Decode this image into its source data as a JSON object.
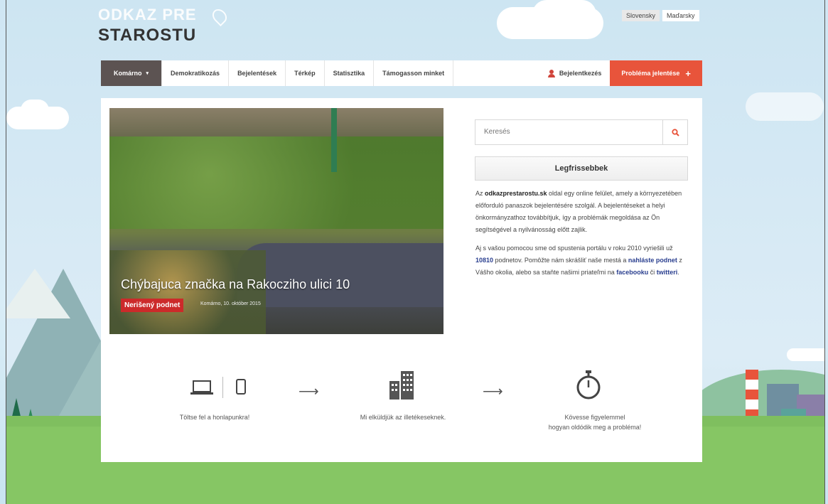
{
  "header": {
    "logo_top": "ODKAZ PRE",
    "logo_bottom": "STAROSTU",
    "languages": [
      "Slovensky",
      "Maďarsky"
    ]
  },
  "nav": {
    "city": "Komárno",
    "items": [
      "Demokratikozás",
      "Bejelentések",
      "Térkép",
      "Statisztika",
      "Támogasson minket"
    ],
    "login": "Bejelentkezés",
    "report": "Probléma jelentése"
  },
  "hero": {
    "title": "Chýbajuca značka na Rakocziho ulici 10",
    "badge": "Nerišený podnet",
    "meta": "Komárno, 10. október 2015"
  },
  "sidebar": {
    "search_placeholder": "Keresés",
    "latest_label": "Legfrissebbek",
    "p1_prefix": "Az ",
    "p1_site": "odkazprestarostu.sk",
    "p1_text": " oldal egy online felület, amely a környezetében előforduló panaszok bejelentésére szolgál. A bejelentéseket a helyi önkormányzathoz továbbítjuk, így a problémák megoldása az Ön segítségével a nyilvánosság előtt zajlik.",
    "p2_a": "Aj s vašou pomocou sme od spustenia portálu v roku 2010 vyriešili už ",
    "p2_num": "10810",
    "p2_b": " podnetov. Pomôžte nám skrášliť naše mestá a ",
    "p2_link1": "nahláste podnet",
    "p2_c": " z Vášho okolia, alebo sa staňte našimi priateľmi na ",
    "p2_link2": "facebooku",
    "p2_d": " či ",
    "p2_link3": "twitteri",
    "p2_e": "."
  },
  "steps": {
    "step1": "Töltse fel a honlapunkra!",
    "step2": "Mi elküldjük az illetékeseknek.",
    "step3_line1": "Kövesse figyelemmel",
    "step3_line2": "hogyan oldódik meg a probléma!"
  },
  "colors": {
    "accent": "#e8543b",
    "nav_city": "#5c5352",
    "badge": "#cc2a2a",
    "link": "#2a3f8f"
  }
}
